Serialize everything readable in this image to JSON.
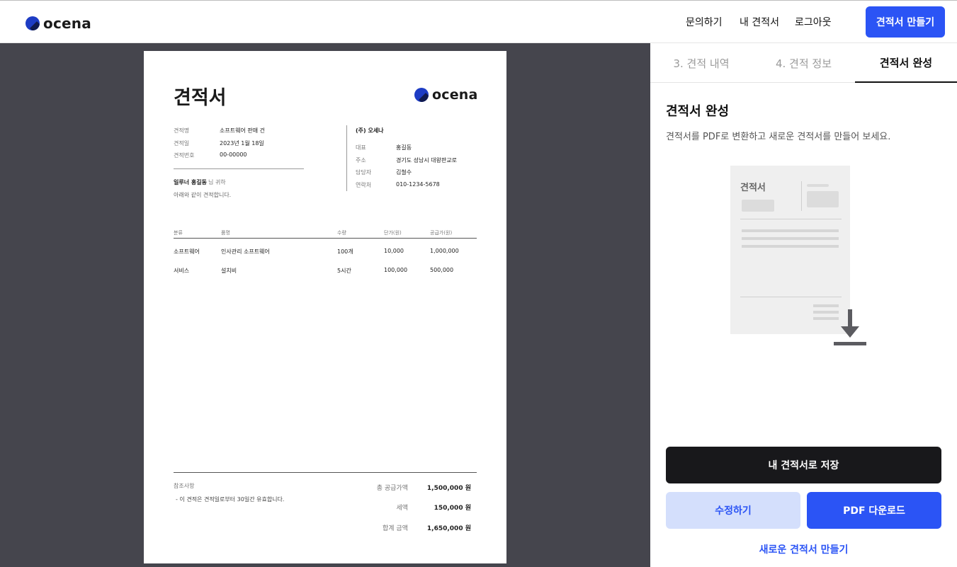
{
  "header": {
    "logo_text": "ocena",
    "nav": [
      "문의하기",
      "내 견적서",
      "로그아웃"
    ],
    "create_button": "견적서 만들기"
  },
  "document": {
    "title": "견적서",
    "logo_text": "ocena",
    "meta": [
      {
        "label": "견적명",
        "value": "소프트웨어 판매 건"
      },
      {
        "label": "견적일",
        "value": "2023년 1월 18일"
      },
      {
        "label": "견적번호",
        "value": "00-00000"
      }
    ],
    "recipient_name": "일루너 홍길동",
    "recipient_suffix": "님 귀하",
    "recipient_note": "아래와 같이 견적합니다.",
    "company": {
      "name": "(주) 오세나",
      "fields": [
        {
          "label": "대표",
          "value": "홍길동"
        },
        {
          "label": "주소",
          "value": "경기도 성남시 대왕판교로"
        },
        {
          "label": "담당자",
          "value": "김철수"
        },
        {
          "label": "연락처",
          "value": "010-1234-5678"
        }
      ]
    },
    "table": {
      "headers": [
        "분류",
        "품명",
        "수량",
        "단가(원)",
        "공급가(원)"
      ],
      "rows": [
        [
          "소프트웨어",
          "인사관리 소프트웨어",
          "100개",
          "10,000",
          "1,000,000"
        ],
        [
          "서비스",
          "설치비",
          "5시간",
          "100,000",
          "500,000"
        ]
      ]
    },
    "notes_label": "참조사항",
    "notes_text": "- 이 견적은 견적일로부터 30일간 유효합니다.",
    "totals": [
      {
        "label": "총 공급가액",
        "value": "1,500,000 원"
      },
      {
        "label": "세액",
        "value": "150,000 원"
      },
      {
        "label": "합계 금액",
        "value": "1,650,000 원"
      }
    ]
  },
  "panel": {
    "tabs": [
      "3. 견적 내역",
      "4. 견적 정보",
      "견적서 완성"
    ],
    "active_tab": 2,
    "title": "견적서 완성",
    "description": "견적서를 PDF로 변환하고 새로운 견적서를 만들어 보세요.",
    "illustration_title": "견적서",
    "save_button": "내 견적서로 저장",
    "edit_button": "수정하기",
    "pdf_button": "PDF 다운로드",
    "new_link": "새로운 견적서 만들기"
  },
  "colors": {
    "accent": "#2b54f5",
    "accent_light": "#d4dffc",
    "dark_button": "#18181b",
    "preview_bg": "#45454d",
    "logo_blue": "#1d3cc4"
  }
}
